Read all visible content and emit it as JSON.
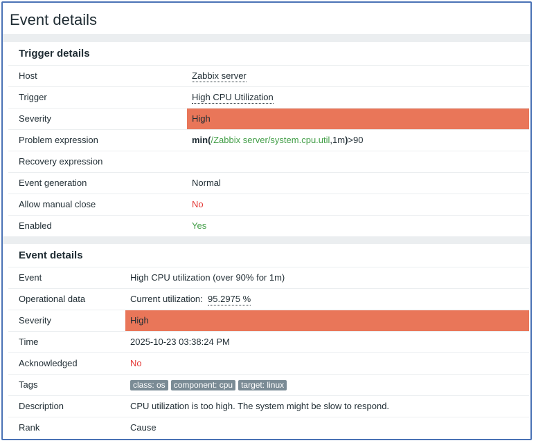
{
  "page_title": "Event details",
  "trigger_details": {
    "title": "Trigger details",
    "host": {
      "label": "Host",
      "value": "Zabbix server"
    },
    "trigger": {
      "label": "Trigger",
      "value": "High CPU Utilization"
    },
    "severity": {
      "label": "Severity",
      "value": "High"
    },
    "problem_expression": {
      "label": "Problem expression",
      "fn_open": "min(",
      "item": "/Zabbix server/system.cpu.util",
      "args_tail": ",1m",
      "close": ")",
      "comparison": ">90"
    },
    "recovery_expression": {
      "label": "Recovery expression",
      "value": ""
    },
    "event_generation": {
      "label": "Event generation",
      "value": "Normal"
    },
    "allow_manual_close": {
      "label": "Allow manual close",
      "value": "No"
    },
    "enabled": {
      "label": "Enabled",
      "value": "Yes"
    }
  },
  "event_details": {
    "title": "Event details",
    "event": {
      "label": "Event",
      "value": "High CPU utilization (over 90% for 1m)"
    },
    "operational_data": {
      "label": "Operational data",
      "prefix": "Current utilization:",
      "value": "95.2975 %"
    },
    "severity": {
      "label": "Severity",
      "value": "High"
    },
    "time": {
      "label": "Time",
      "value": "2025-10-23 03:38:24 PM"
    },
    "acknowledged": {
      "label": "Acknowledged",
      "value": "No"
    },
    "tags": {
      "label": "Tags",
      "items": [
        "class: os",
        "component: cpu",
        "target: linux"
      ]
    },
    "description": {
      "label": "Description",
      "value": "CPU utilization is too high. The system might be slow to respond."
    },
    "rank": {
      "label": "Rank",
      "value": "Cause"
    }
  },
  "colors": {
    "severity_high": "#e97659",
    "no_red": "#e33734",
    "yes_green": "#429e47",
    "frame_border": "#4a72b5",
    "tag_bg": "#7a8b95"
  }
}
